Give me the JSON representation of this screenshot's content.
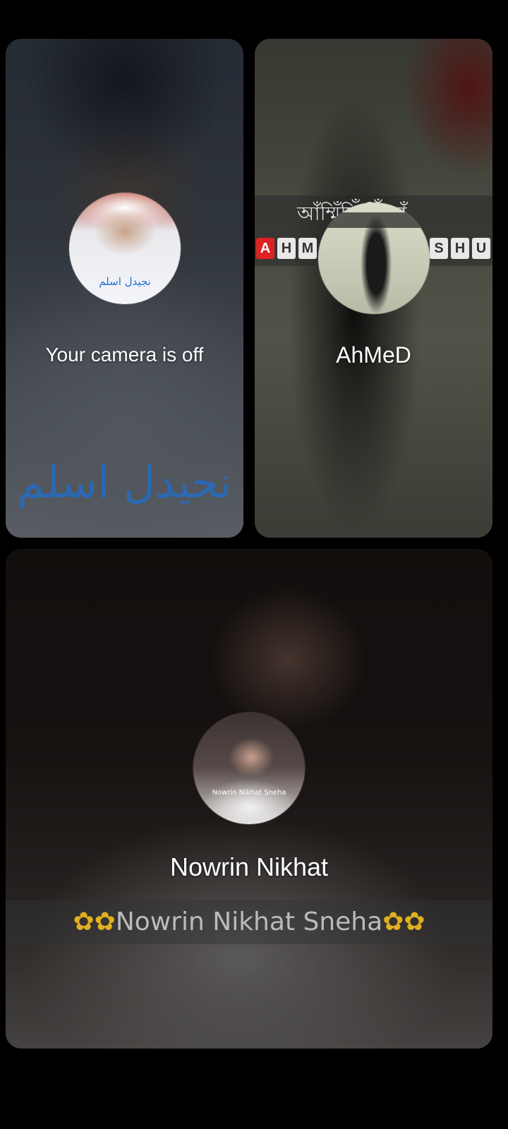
{
  "participants": [
    {
      "name": "Your camera is off",
      "avatar_caption": "نجيدل اسلم",
      "background_caption": "نحيدل اسلم"
    },
    {
      "name": "AhMeD",
      "banner_bengali": "আঁম্মিঁয়িঁ কিঁজাঁ",
      "banner_letters": [
        "A",
        "H",
        "M",
        "S",
        "H",
        "U"
      ]
    },
    {
      "name": "Nowrin Nikhat",
      "avatar_caption": "Nowrin Nikhat Sneha",
      "background_caption": "Nowrin Nikhat Sneha"
    }
  ],
  "colors": {
    "background": "#000000",
    "name_text": "#ffffff",
    "caption_blue": "#1e6fd0"
  }
}
